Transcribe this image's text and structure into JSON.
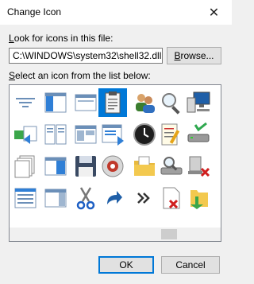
{
  "window": {
    "title": "Change Icon",
    "close_glyph": "✕"
  },
  "file_field": {
    "label_prefix": "",
    "label_accel": "L",
    "label_rest": "ook for icons in this file:",
    "value": "C:\\WINDOWS\\system32\\shell32.dll"
  },
  "browse_button": {
    "accel": "B",
    "rest": "rowse..."
  },
  "list": {
    "label_prefix": "",
    "label_accel": "S",
    "label_rest": "elect an icon from the list below:",
    "selected_index": 3,
    "icons": [
      "filter-lines-icon",
      "window-left-pane-icon",
      "window-pane-icon",
      "clipboard-icon",
      "users-icon",
      "magnifier-icon",
      "monitor-network-icon",
      "globe-partial-icon",
      "window-arrow-icon",
      "book-pages-icon",
      "window-layout-icon",
      "window-list-icon",
      "clock-icon",
      "notepad-pencil-icon",
      "drive-check-icon",
      "blue-circle-partial-icon",
      "stacked-pages-icon",
      "window-split-icon",
      "floppy-disk-icon",
      "disc-icon",
      "folder-pages-icon",
      "search-drive-icon",
      "network-drive-error-icon",
      "drive-error-partial-icon",
      "window-grid-icon",
      "window-column-icon",
      "scissors-icon",
      "shortcut-arrow-icon",
      "double-chevron-icon",
      "document-error-icon",
      "folder-arrow-icon",
      "yellow-partial-icon"
    ]
  },
  "ok_button": {
    "label": "OK"
  },
  "cancel_button": {
    "label": "Cancel"
  }
}
